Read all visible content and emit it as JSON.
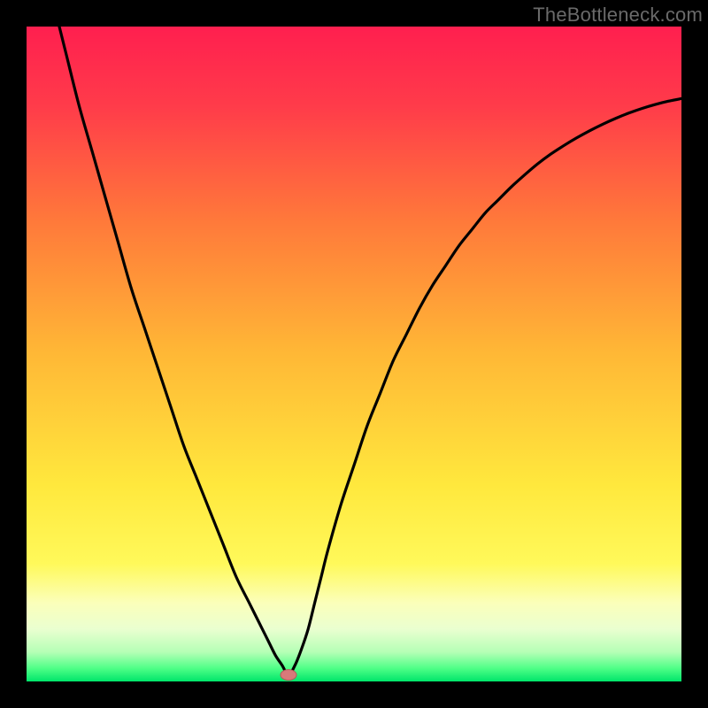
{
  "watermark": "TheBottleneck.com",
  "colors": {
    "frame": "#000000",
    "curve": "#000000",
    "marker_fill": "#d97a7a",
    "marker_stroke": "#b55a5a",
    "gradient_stops": [
      {
        "offset": 0.0,
        "color": "#ff1f4f"
      },
      {
        "offset": 0.12,
        "color": "#ff3b4a"
      },
      {
        "offset": 0.3,
        "color": "#ff7a3a"
      },
      {
        "offset": 0.5,
        "color": "#ffb836"
      },
      {
        "offset": 0.7,
        "color": "#ffe83d"
      },
      {
        "offset": 0.82,
        "color": "#fff95a"
      },
      {
        "offset": 0.88,
        "color": "#fbffba"
      },
      {
        "offset": 0.92,
        "color": "#eaffd0"
      },
      {
        "offset": 0.955,
        "color": "#b6ffb6"
      },
      {
        "offset": 0.98,
        "color": "#4fff87"
      },
      {
        "offset": 1.0,
        "color": "#00e56a"
      }
    ]
  },
  "chart_data": {
    "type": "line",
    "title": "",
    "xlabel": "",
    "ylabel": "",
    "xlim": [
      0,
      100
    ],
    "ylim": [
      0,
      100
    ],
    "grid": false,
    "legend": "none",
    "marker": {
      "x": 40,
      "y": 1
    },
    "x": [
      0,
      2,
      4,
      6,
      8,
      10,
      12,
      14,
      16,
      18,
      20,
      22,
      24,
      26,
      28,
      30,
      32,
      34,
      35,
      36,
      37,
      38,
      39,
      40,
      41,
      42,
      43,
      44,
      45,
      46,
      48,
      50,
      52,
      54,
      56,
      58,
      60,
      62,
      64,
      66,
      68,
      70,
      72,
      74,
      76,
      78,
      80,
      82,
      84,
      86,
      88,
      90,
      92,
      94,
      96,
      98,
      100
    ],
    "values": [
      121,
      112,
      104,
      96,
      88,
      81,
      74,
      67,
      60,
      54,
      48,
      42,
      36,
      31,
      26,
      21,
      16,
      12,
      10,
      8,
      6,
      4,
      2.5,
      1,
      2.5,
      5,
      8,
      12,
      16,
      20,
      27,
      33,
      39,
      44,
      49,
      53,
      57,
      60.5,
      63.5,
      66.5,
      69,
      71.5,
      73.5,
      75.5,
      77.3,
      79,
      80.5,
      81.8,
      83,
      84.1,
      85.1,
      86,
      86.8,
      87.5,
      88.1,
      88.6,
      89
    ]
  }
}
